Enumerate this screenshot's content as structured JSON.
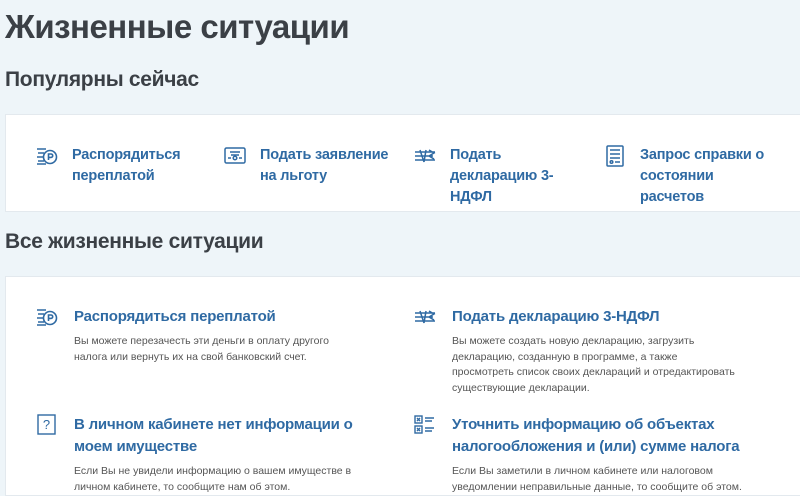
{
  "page_title": "Жизненные ситуации",
  "popular": {
    "heading": "Популярны сейчас",
    "items": [
      {
        "label": "Распорядиться переплатой",
        "icon": "ruble-coins-icon"
      },
      {
        "label": "Подать заявление на льготу",
        "icon": "certificate-icon"
      },
      {
        "label": "Подать декларацию 3-НДФЛ",
        "icon": "declaration-icon"
      },
      {
        "label": "Запрос справки о состоянии расчетов",
        "icon": "document-list-icon"
      }
    ]
  },
  "all": {
    "heading": "Все жизненные ситуации",
    "items": [
      {
        "title": "Распорядиться переплатой",
        "desc": "Вы можете перезачесть эти деньги в оплату другого налога или вернуть их на свой банковский счет.",
        "icon": "ruble-coins-icon"
      },
      {
        "title": "Подать декларацию 3-НДФЛ",
        "desc": "Вы можете создать новую декларацию, загрузить декларацию, созданную в программе, а также просмотреть список своих деклараций и отредактировать существующие декларации.",
        "icon": "declaration-icon"
      },
      {
        "title": "В личном кабинете нет информации о моем имуществе",
        "desc": "Если Вы не увидели информацию о вашем имуществе в личном кабинете, то сообщите нам об этом.",
        "icon": "question-icon"
      },
      {
        "title": "Уточнить информацию об объектах налогообложения и (или) сумме налога",
        "desc": "Если Вы заметили в личном кабинете или налоговом уведомлении неправильные данные, то сообщите об этом.",
        "icon": "checklist-icon"
      }
    ]
  }
}
